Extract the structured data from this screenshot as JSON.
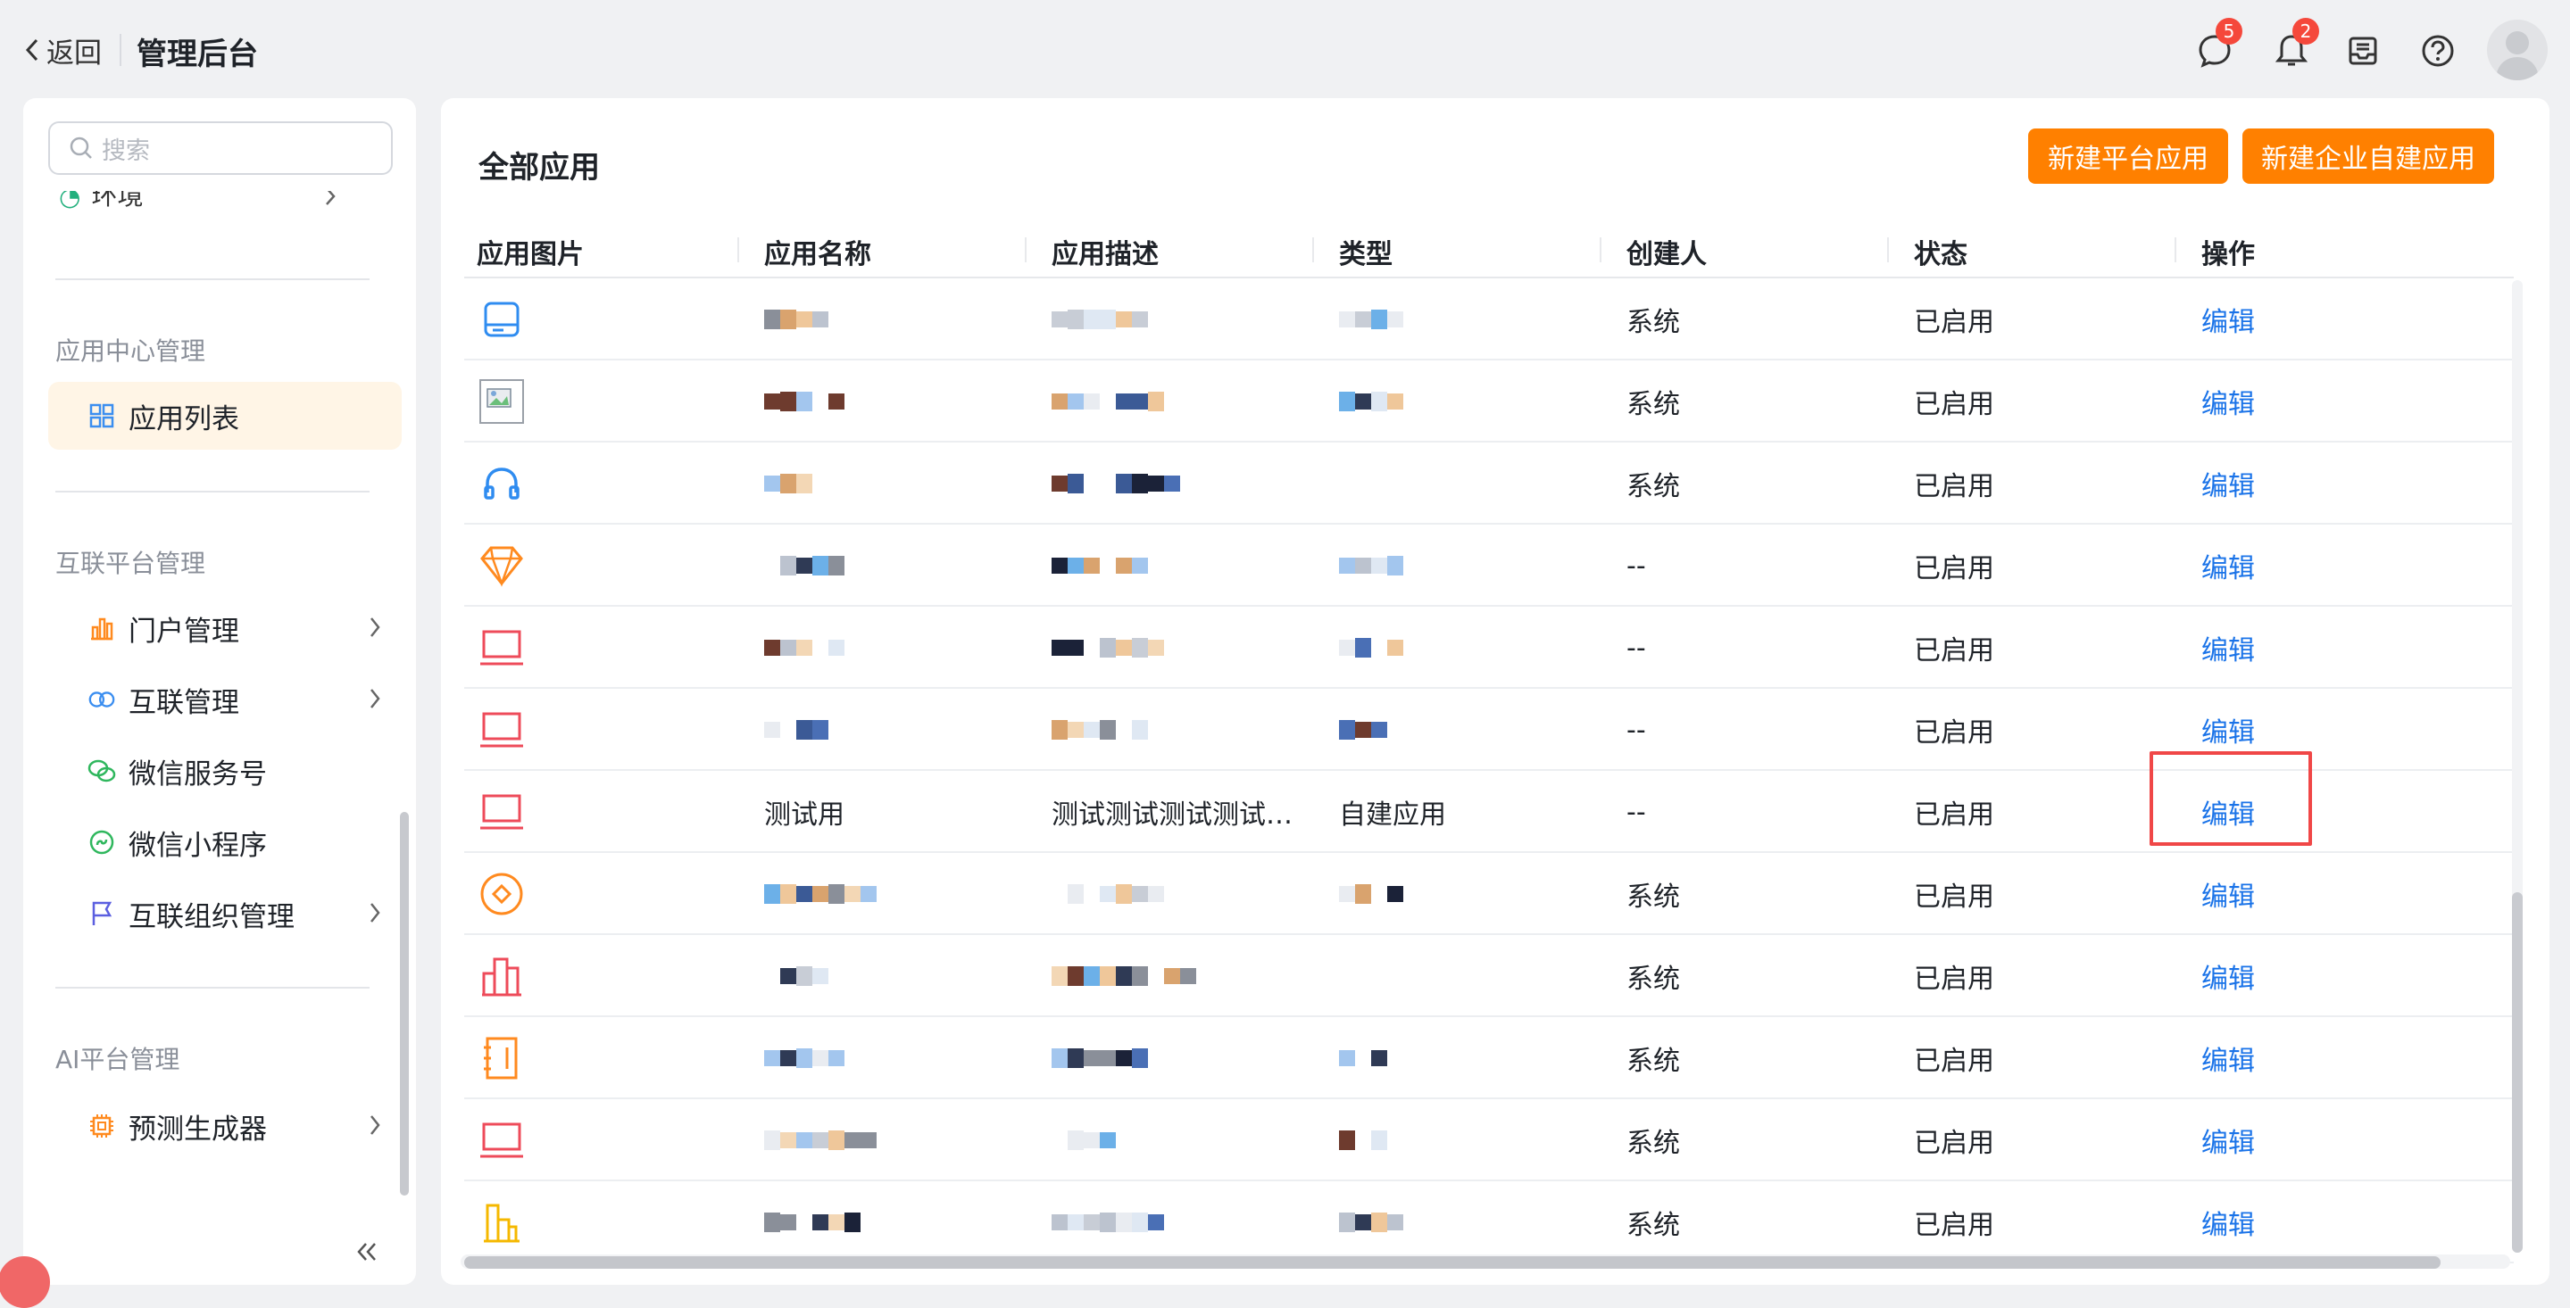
{
  "topbar": {
    "back_label": "返回",
    "title": "管理后台",
    "message_badge": "5",
    "bell_badge": "2"
  },
  "sidebar": {
    "search_placeholder": "搜索",
    "partial_item": "环境",
    "groups": [
      {
        "title": "应用中心管理",
        "items": [
          {
            "label": "应用列表",
            "active": true,
            "icon": "grid-icon"
          }
        ]
      },
      {
        "title": "互联平台管理",
        "items": [
          {
            "label": "门户管理",
            "icon": "portal-chart-icon",
            "chevron": true
          },
          {
            "label": "互联管理",
            "icon": "link-circles-icon",
            "chevron": true
          },
          {
            "label": "微信服务号",
            "icon": "wechat-icon"
          },
          {
            "label": "微信小程序",
            "icon": "mini-program-icon"
          },
          {
            "label": "互联组织管理",
            "icon": "flag-icon",
            "chevron": true
          }
        ]
      },
      {
        "title": "AI平台管理",
        "items": [
          {
            "label": "预测生成器",
            "icon": "chip-icon",
            "chevron": true
          }
        ]
      }
    ]
  },
  "main": {
    "title": "全部应用",
    "btn_platform": "新建平台应用",
    "btn_enterprise": "新建企业自建应用",
    "columns": [
      "应用图片",
      "应用名称",
      "应用描述",
      "类型",
      "创建人",
      "状态",
      "操作"
    ],
    "rows": [
      {
        "icon": "drive-icon",
        "creator": "系统",
        "status": "已启用",
        "action": "编辑"
      },
      {
        "icon": "broken-image-icon",
        "creator": "系统",
        "status": "已启用",
        "action": "编辑"
      },
      {
        "icon": "headphones-icon",
        "creator": "系统",
        "status": "已启用",
        "action": "编辑"
      },
      {
        "icon": "diamond-icon",
        "creator": "--",
        "status": "已启用",
        "action": "编辑"
      },
      {
        "icon": "laptop-icon",
        "creator": "--",
        "status": "已启用",
        "action": "编辑"
      },
      {
        "icon": "laptop-icon",
        "creator": "--",
        "status": "已启用",
        "action": "编辑"
      },
      {
        "icon": "laptop-icon",
        "name": "测试用",
        "desc": "测试测试测试测试…",
        "type": "自建应用",
        "creator": "--",
        "status": "已启用",
        "action": "编辑",
        "highlighted": true
      },
      {
        "icon": "coin-icon",
        "creator": "系统",
        "status": "已启用",
        "action": "编辑"
      },
      {
        "icon": "building-icon",
        "creator": "系统",
        "status": "已启用",
        "action": "编辑"
      },
      {
        "icon": "notebook-icon",
        "creator": "系统",
        "status": "已启用",
        "action": "编辑"
      },
      {
        "icon": "laptop-icon",
        "creator": "系统",
        "status": "已启用",
        "action": "编辑"
      },
      {
        "icon": "chart-bar-icon",
        "creator": "系统",
        "status": "已启用",
        "action": "编辑"
      }
    ]
  },
  "colors": {
    "accent": "#ff8000",
    "link": "#1a73e8",
    "active_bg": "#fff5e6",
    "badge": "#f5483b",
    "highlight": "#f04747"
  }
}
